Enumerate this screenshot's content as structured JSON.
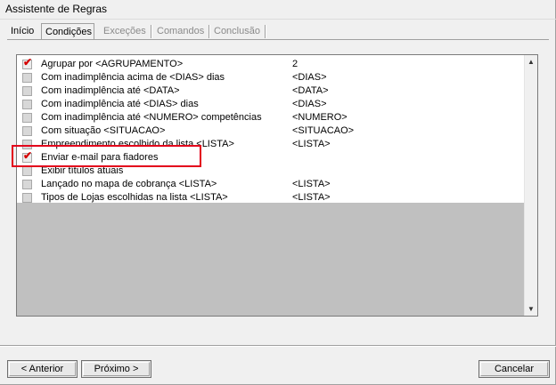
{
  "window": {
    "title": "Assistente de Regras"
  },
  "tabs": [
    {
      "label": "Início",
      "state": "normal"
    },
    {
      "label": "Condições",
      "state": "active"
    },
    {
      "label": "Exceções",
      "state": "disabled"
    },
    {
      "label": "Comandos",
      "state": "disabled"
    },
    {
      "label": "Conclusão",
      "state": "disabled"
    }
  ],
  "conditions": [
    {
      "label": "Agrupar por <AGRUPAMENTO>",
      "value": "2",
      "checked": true
    },
    {
      "label": "Com inadimplência acima de <DIAS> dias",
      "value": "<DIAS>",
      "checked": false
    },
    {
      "label": "Com inadimplência até <DATA>",
      "value": "<DATA>",
      "checked": false
    },
    {
      "label": "Com inadimplência até <DIAS>  dias",
      "value": "<DIAS>",
      "checked": false
    },
    {
      "label": "Com inadimplência até <NUMERO> competências",
      "value": "<NUMERO>",
      "checked": false
    },
    {
      "label": "Com situação <SITUACAO>",
      "value": "<SITUACAO>",
      "checked": false
    },
    {
      "label": "Empreendimento escolhido da lista <LISTA>",
      "value": "<LISTA>",
      "checked": false
    },
    {
      "label": "Enviar e-mail para fiadores",
      "value": "",
      "checked": true
    },
    {
      "label": "Exibir títulos atuais",
      "value": "",
      "checked": false
    },
    {
      "label": "Lançado no mapa de cobrança <LISTA>",
      "value": "<LISTA>",
      "checked": false
    },
    {
      "label": "Tipos de Lojas escolhidas na lista <LISTA>",
      "value": "<LISTA>",
      "checked": false
    }
  ],
  "scroll": {
    "up_icon": "▲",
    "down_icon": "▼"
  },
  "buttons": {
    "previous": "< Anterior",
    "next": "Próximo >",
    "cancel": "Cancelar"
  },
  "colors": {
    "highlight": "#e3001b",
    "checkmark": "#d40000"
  }
}
